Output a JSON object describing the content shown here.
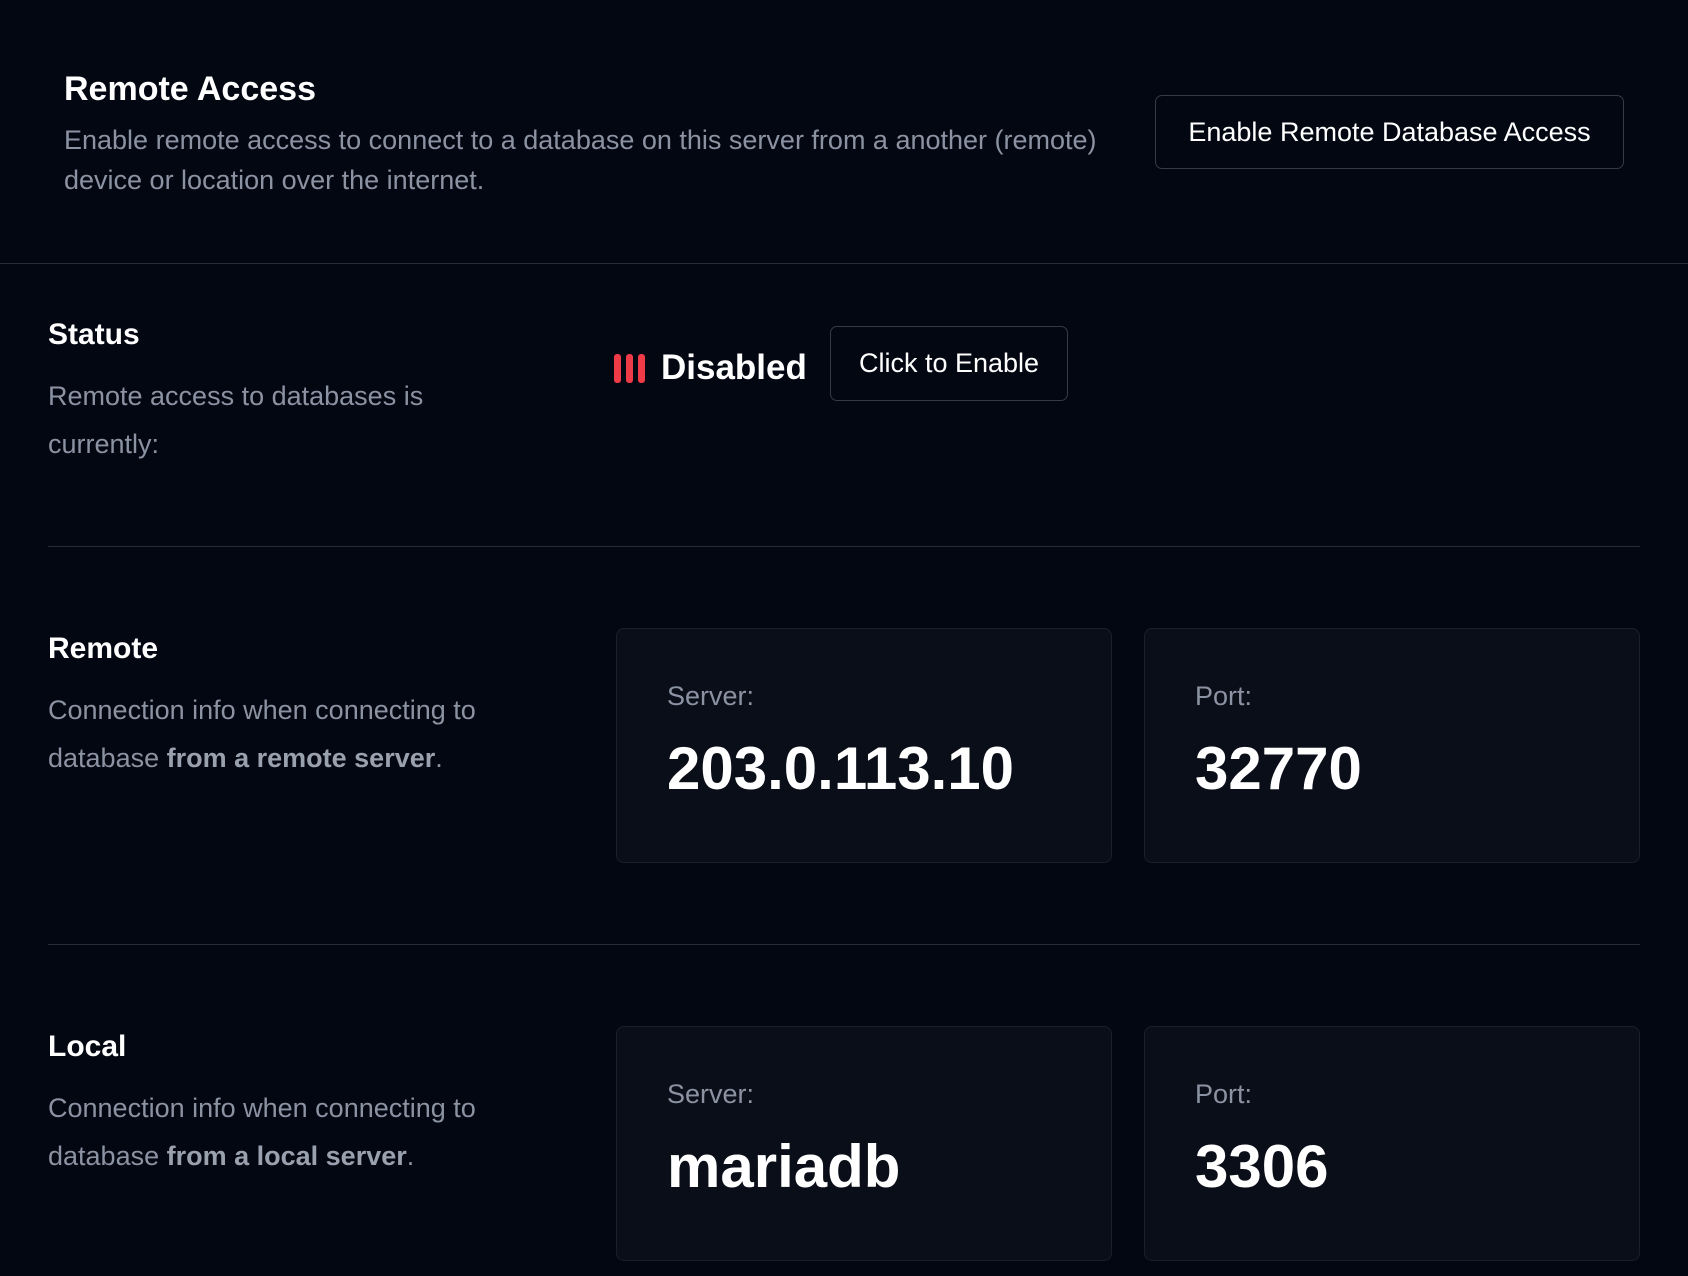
{
  "header": {
    "title": "Remote Access",
    "description": "Enable remote access to connect to a database on this server from a another (remote) device or location over the internet.",
    "enable_button": "Enable Remote Database Access"
  },
  "status": {
    "title": "Status",
    "description": "Remote access to databases is currently:",
    "state": "Disabled",
    "state_color": "#ef3b47",
    "enable_button": "Click to Enable"
  },
  "remote": {
    "title": "Remote",
    "description_prefix": "Connection info when connecting to database ",
    "description_bold": "from a remote server",
    "description_suffix": ".",
    "server_label": "Server:",
    "server_value": "203.0.113.10",
    "port_label": "Port:",
    "port_value": "32770"
  },
  "local": {
    "title": "Local",
    "description_prefix": "Connection info when connecting to database ",
    "description_bold": "from a local server",
    "description_suffix": ".",
    "server_label": "Server:",
    "server_value": "mariadb",
    "port_label": "Port:",
    "port_value": "3306"
  }
}
